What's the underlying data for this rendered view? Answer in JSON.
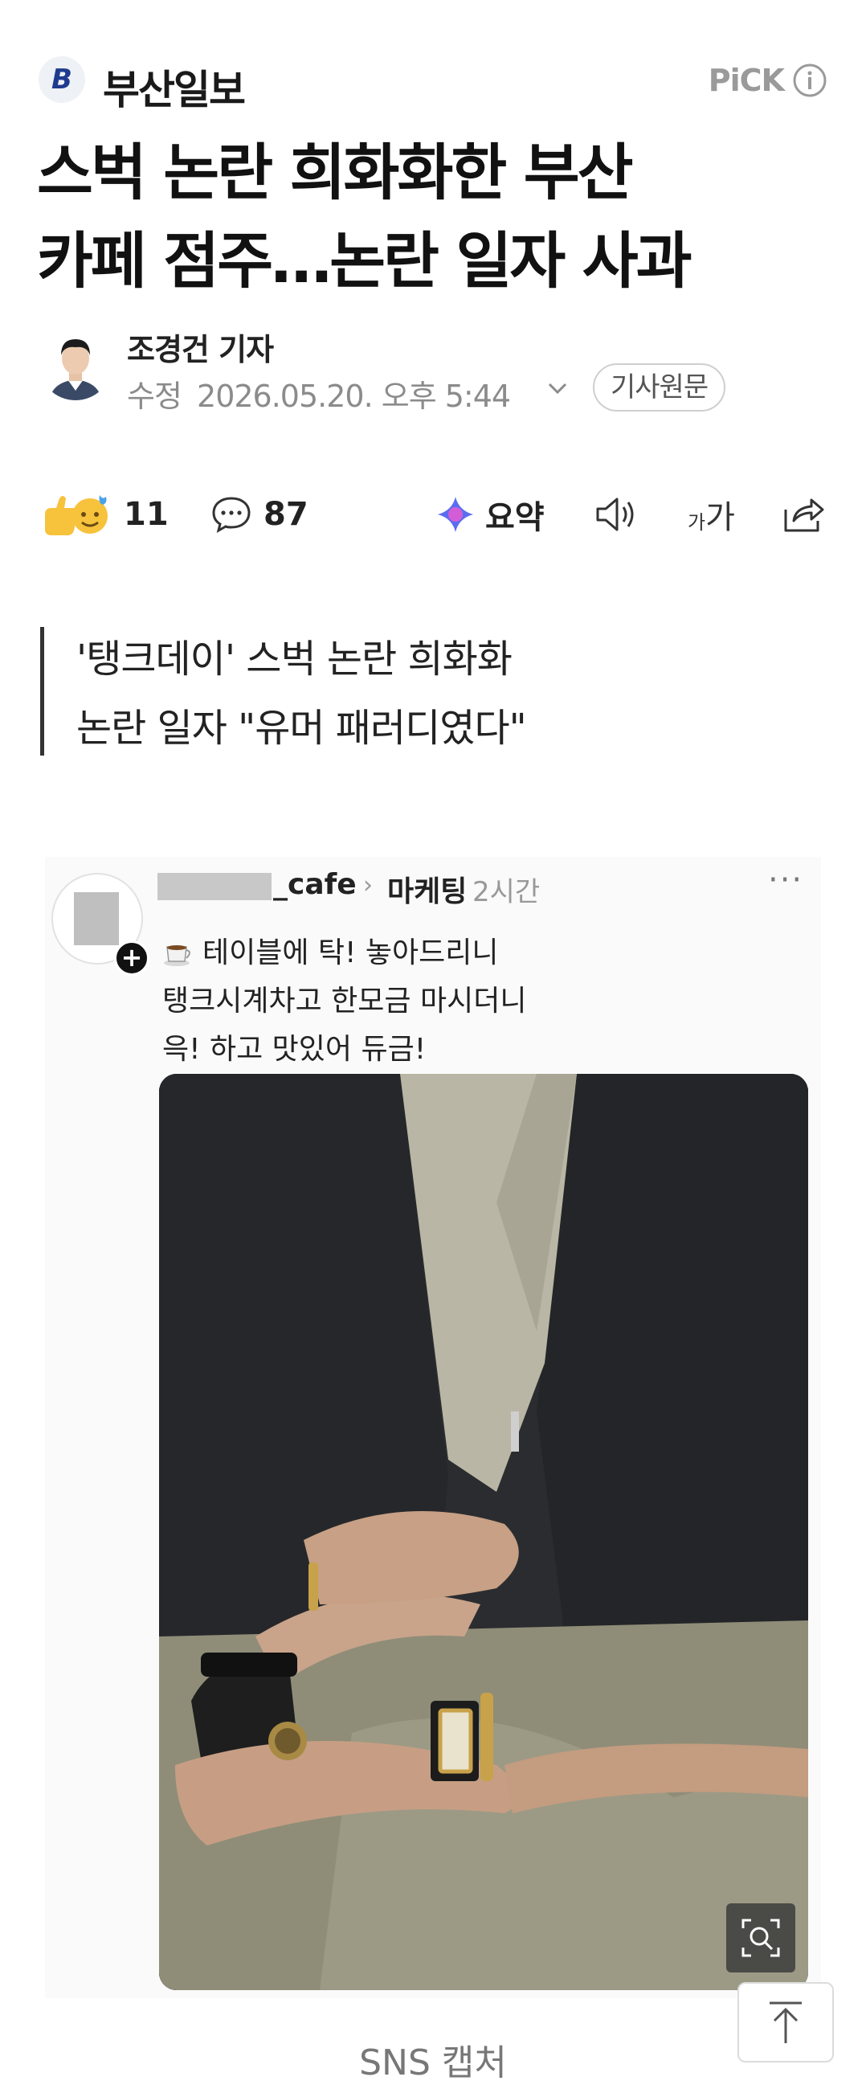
{
  "press": {
    "logo_letter": "B",
    "name": "부산일보",
    "pick_label": "PiCK"
  },
  "headline": {
    "line1": "스벅 논란 희화화한 부산",
    "line2": "카페 점주…논란 일자 사과"
  },
  "byline": {
    "reporter": "조경건 기자",
    "modified_label": "수정",
    "datetime": "2026.05.20. 오후 5:44",
    "original_button": "기사원문"
  },
  "actions": {
    "reactions_count": "11",
    "comments_count": "87",
    "summary_label": "요약",
    "font_small": "가",
    "font_large": "가"
  },
  "summary": {
    "line1": "'탱크데이' 스벅 논란 희화화",
    "line2": "논란 일자 \"유머 패러디였다\""
  },
  "sns_post": {
    "username": "_cafe",
    "category": "마케팅",
    "time": "2시간",
    "text_line1": "테이블에 탁! 놓아드리니",
    "text_line2": "탱크시계차고 한모금 마시더니",
    "text_line3": "윽! 하고 맛있어 듀금!"
  },
  "caption": "SNS 캡처",
  "colors": {
    "accent_blue": "#1f3b8f",
    "text_dark": "#111111",
    "text_gray": "#8b8b8b"
  }
}
